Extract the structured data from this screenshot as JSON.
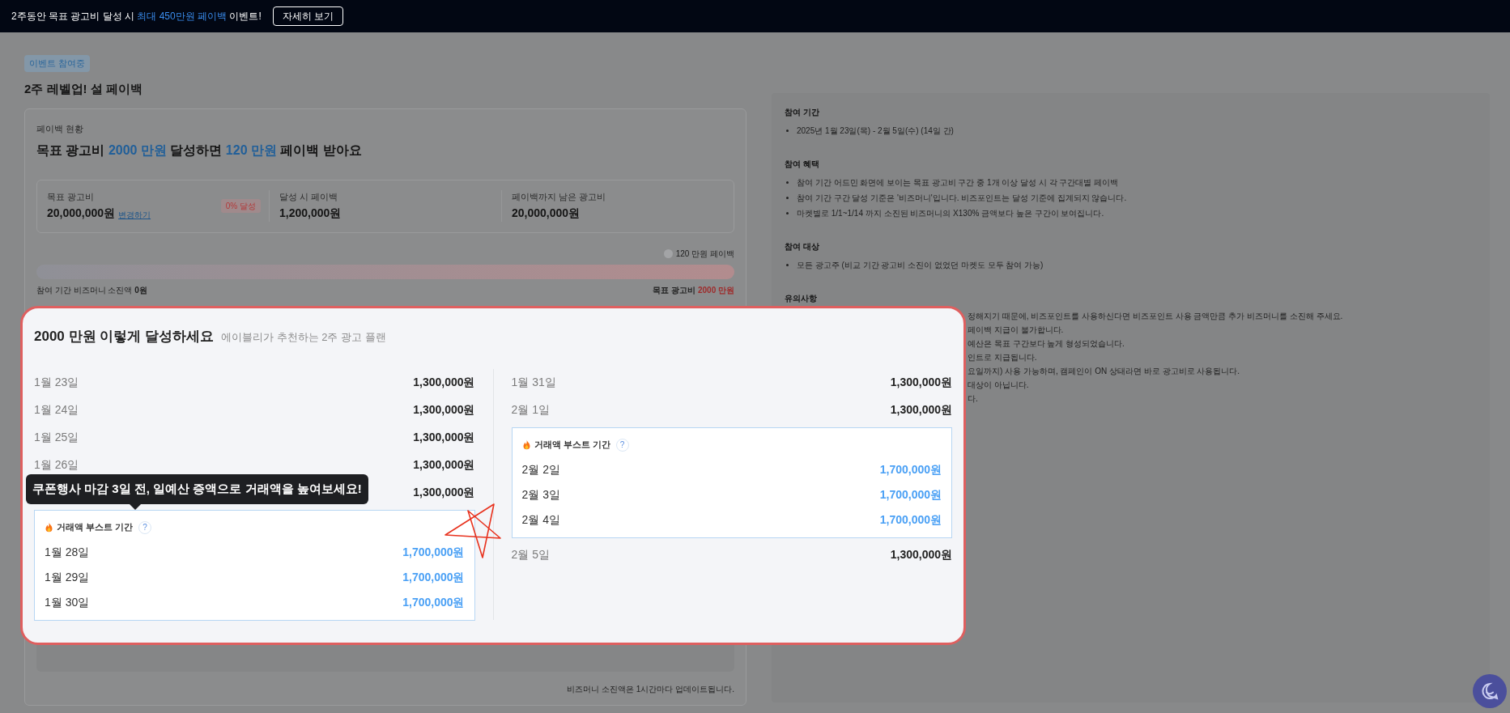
{
  "banner": {
    "prefix": "2주동안 목표 광고비 달성 시 ",
    "highlight": "최대 450만원 페이백",
    "suffix": " 이벤트!",
    "button": "자세히 보기"
  },
  "event": {
    "badge": "이벤트 참여중",
    "title": "2주 레벨업! 설 페이백"
  },
  "status": {
    "label": "페이백 현황",
    "headline": [
      {
        "text": "목표 광고비 ",
        "accent": false
      },
      {
        "text": "2000 만원",
        "accent": true
      },
      {
        "text": " 달성하면 ",
        "accent": false
      },
      {
        "text": "120 만원",
        "accent": true
      },
      {
        "text": " 페이백 받아요",
        "accent": false
      }
    ]
  },
  "stats": [
    {
      "label": "목표 광고비",
      "value": "20,000,000원",
      "link": "변경하기",
      "badge": "0% 달성"
    },
    {
      "label": "달성 시 페이백",
      "value": "1,200,000원"
    },
    {
      "label": "페이백까지 남은 광고비",
      "value": "20,000,000원"
    }
  ],
  "progress": {
    "milestone": "120 만원 페이백",
    "level": 0,
    "left_label": "참여 기간 비즈머니 소진액",
    "left_value": "0원",
    "right_label": "목표 광고비",
    "right_value": "2000 만원"
  },
  "footnote": "비즈머니 소진액은 1시간마다 업데이트됩니다.",
  "info": [
    {
      "title": "참여 기간",
      "kind": "list",
      "items": [
        "2025년 1월 23일(목) - 2월 5일(수) (14일 간)"
      ]
    },
    {
      "title": "참여 혜택",
      "kind": "list",
      "items": [
        "참여 기간 어드민 화면에 보이는 목표 광고비 구간 중 1개 이상 달성 시 각 구간대별 페이백",
        "참여 기간 구간 달성 기준은 '비즈머니'입니다. 비즈포인트는 달성 기준에 집계되지 않습니다.",
        "마켓별로 1/1~1/14 까지 소진된 비즈머니의 X130% 금액보다 높은 구간이 보여집니다."
      ]
    },
    {
      "title": "참여 대상",
      "kind": "list",
      "items": [
        "모든 광고주 (비교 기간 광고비 소진이 없었던 마켓도 모두 참여 가능)"
      ]
    },
    {
      "title": "유의사항",
      "kind": "clipped",
      "items": [
        "정해지기 때문에, 비즈포인트를 사용하신다면 비즈포인트 사용 금액만큼 추가 비즈머니를 소진해 주세요.",
        "페이백 지급이 불가합니다.",
        "예산은 목표 구간보다 높게 형성되었습니다.",
        "인트로 지급됩니다.",
        "요일까지) 사용 가능하며, 캠페인이 ON 상태라면 바로 광고비로 사용됩니다.",
        "대상이 아닙니다.",
        "다."
      ]
    }
  ],
  "plan": {
    "title": "2000 만원 이렇게 달성하세요",
    "subtitle": "에이블리가 추천하는 2주 광고 플랜",
    "tooltip": "쿠폰행사 마감 3일 전, 일예산 증액으로 거래액을 높여보세요!",
    "columns": [
      [
        {
          "kind": "day",
          "date": "1월 23일",
          "amount": "1,300,000원"
        },
        {
          "kind": "day",
          "date": "1월 24일",
          "amount": "1,300,000원"
        },
        {
          "kind": "day",
          "date": "1월 25일",
          "amount": "1,300,000원"
        },
        {
          "kind": "day",
          "date": "1월 26일",
          "amount": "1,300,000원"
        },
        {
          "kind": "day",
          "amount": "1,300,000원",
          "tooltip": true
        },
        {
          "kind": "boost",
          "label": "거래액 부스트 기간",
          "help": "?",
          "days": [
            {
              "date": "1월 28일",
              "amount": "1,700,000원"
            },
            {
              "date": "1월 29일",
              "amount": "1,700,000원"
            },
            {
              "date": "1월 30일",
              "amount": "1,700,000원"
            }
          ]
        }
      ],
      [
        {
          "kind": "day",
          "date": "1월 31일",
          "amount": "1,300,000원"
        },
        {
          "kind": "day",
          "date": "2월 1일",
          "amount": "1,300,000원"
        },
        {
          "kind": "boost",
          "label": "거래액 부스트 기간",
          "help": "?",
          "days": [
            {
              "date": "2월 2일",
              "amount": "1,700,000원"
            },
            {
              "date": "2월 3일",
              "amount": "1,700,000원"
            },
            {
              "date": "2월 4일",
              "amount": "1,700,000원"
            }
          ]
        },
        {
          "kind": "day",
          "date": "2월 5일",
          "amount": "1,300,000원"
        }
      ]
    ]
  }
}
